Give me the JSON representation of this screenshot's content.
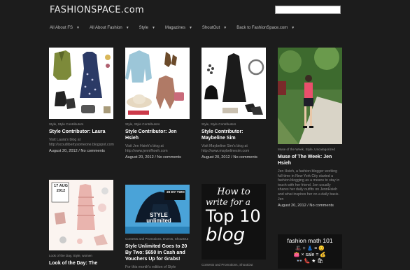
{
  "header": {
    "logo": "FASHIONSPACE.com",
    "search_placeholder": ""
  },
  "nav": [
    {
      "label": "All About FS"
    },
    {
      "label": "All About Fashion"
    },
    {
      "label": "Style"
    },
    {
      "label": "Magazines"
    },
    {
      "label": "ShoutOut"
    },
    {
      "label": "Back to FashionSpace.com"
    }
  ],
  "posts": [
    {
      "image": "outfit-collage-green-vest-dress",
      "categories": "Style, Style Contributors",
      "title": "Style Contributor: Laura",
      "excerpt": "Visit Laura's blog at http://scoutlibertysomeone.blogspot.com",
      "date": "August 20, 2012",
      "comments": "No comments"
    },
    {
      "image": "outfit-collage-denim-shirt-hat",
      "categories": "Style, Style Contributors",
      "title": "Style Contributor: Jen Hsieh",
      "excerpt": "Visit Jen Hsieh's blog at http://www.jennifhoeh.com",
      "date": "August 20, 2012",
      "comments": "No comments"
    },
    {
      "image": "outfit-collage-black-dress-bag",
      "categories": "Style, Style Contributors",
      "title": "Style Contributor: Maybeline Sim",
      "excerpt": "Visit Maybeline Sim's blog at http://www.maybelinesim.com",
      "date": "August 20, 2012",
      "comments": "No comments"
    },
    {
      "image": "street-style-photo-pink-top",
      "categories": "Muse of the Week, Style, Uncategorized",
      "title": "Muse of The Week: Jen Hsieh",
      "excerpt": "Jen Hsieh, a fashion blogger working full-time in New York City started a fashion blogging as a means to stay in touch with her friend. Jen usually shares her daily outfits on JennHsieh and what inspires her on a daily basis. Jen",
      "date": "August 20, 2012",
      "comments": "No comments"
    },
    {
      "image": "look-of-the-day-pink-dress",
      "badge": "17 AUG 2012",
      "categories": "Look of the Day, Style, women",
      "title": "Look of the Day: The"
    },
    {
      "image": "style-unlimited-promo",
      "banner_top": "20 BY TWO",
      "banner_main": "STYLE unlimited",
      "categories": "Contests and Promotions, Events, ShoutOut",
      "title": "Style Unlimited Goes to 20 By Two: $650 in Cash and Vouchers Up for Grabs!",
      "excerpt": "For this month's edition of Style"
    },
    {
      "image": "how-to-write-top-10-blog",
      "lines": [
        "How to",
        "write for a",
        "Top 10",
        "blog"
      ],
      "categories": "Contests and Promotions, ShoutOut"
    },
    {
      "image": "fashion-math-101",
      "heading": "fashion math 101",
      "row1": "🎩 + 👗 = 😊",
      "row2": "👛 × sale = 💰",
      "row3": "👓 👠 ★ 🛍"
    }
  ]
}
